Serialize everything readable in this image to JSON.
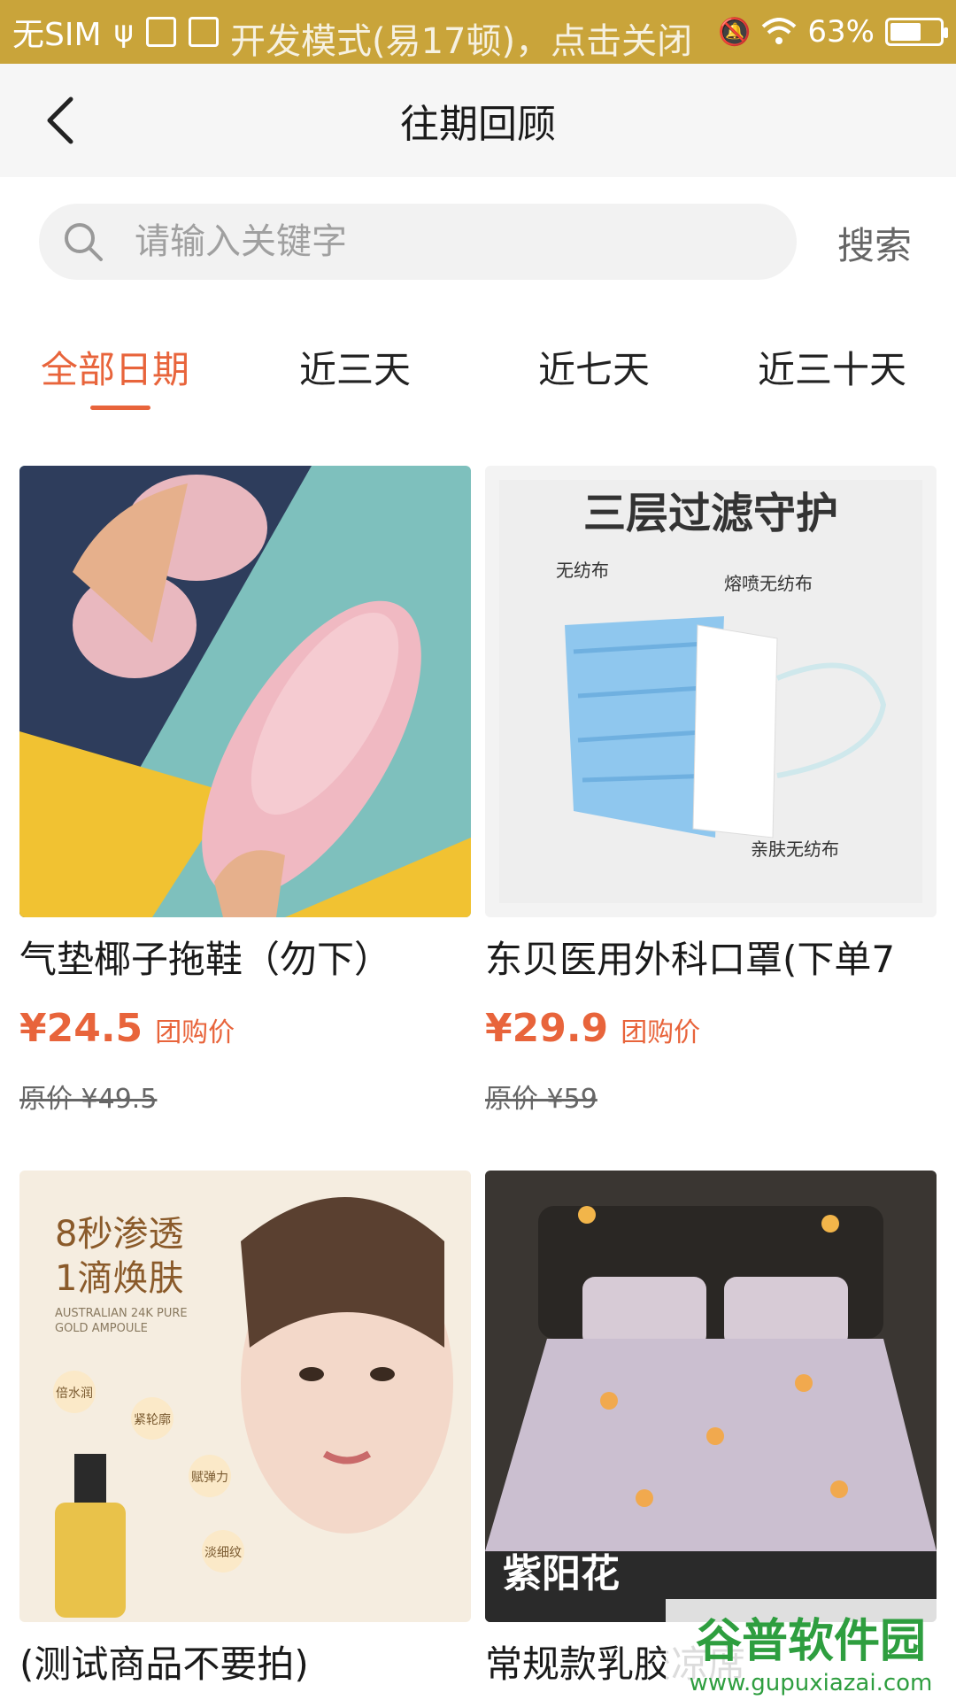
{
  "status_bar": {
    "carrier": "无SIM",
    "dev_mode": "开发模式(易17顿)，点击关闭",
    "battery": "63%",
    "battery_level": 0.63
  },
  "header": {
    "title": "往期回顾"
  },
  "search": {
    "placeholder": "请输入关键字",
    "button_label": "搜索"
  },
  "tabs": [
    {
      "label": "全部日期",
      "active": true
    },
    {
      "label": "近三天",
      "active": false
    },
    {
      "label": "近七天",
      "active": false
    },
    {
      "label": "近三十天",
      "active": false
    }
  ],
  "products": [
    {
      "name": "气垫椰子拖鞋（勿下）",
      "price": "¥24.5",
      "price_label": "团购价",
      "original_price": "原价 ¥49.5"
    },
    {
      "name": "东贝医用外科口罩(下单7",
      "price": "¥29.9",
      "price_label": "团购价",
      "original_price": "原价 ¥59",
      "image_text": {
        "title": "三层过滤守护",
        "layer1": "无纺布",
        "layer2": "熔喷无纺布",
        "layer3": "亲肤无纺布"
      }
    },
    {
      "name": "(测试商品不要拍)",
      "image_text": {
        "line1": "8秒渗透",
        "line2": "1滴焕肤",
        "sub1": "AUSTRALIAN 24K PURE",
        "sub2": "GOLD AMPOULE",
        "b1": "倍水润",
        "b2": "紧轮廓",
        "b3": "赋弹力",
        "b4": "淡细纹"
      }
    },
    {
      "name": "常规款乳胶凉席",
      "image_text": {
        "label": "紫阳花"
      }
    }
  ],
  "watermark": {
    "title": "谷普软件园",
    "url": "www.gupuxiazai.com"
  },
  "colors": {
    "status_bar": "#C9A43A",
    "accent": "#E8643B",
    "header_bg": "#f6f6f6"
  }
}
